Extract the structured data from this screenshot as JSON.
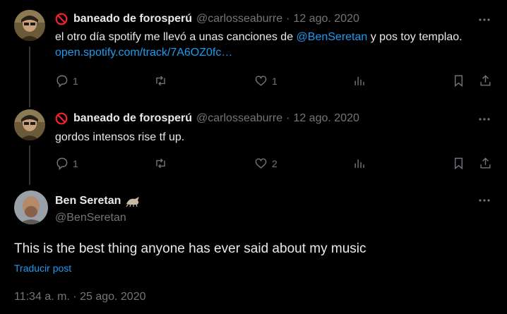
{
  "tweets": [
    {
      "display_name": "baneado de forosperú",
      "handle": "@carlosseaburre",
      "date": "12 ago. 2020",
      "text_pre": "el otro día spotify me llevó a unas canciones de ",
      "mention": "@BenSeretan",
      "text_mid": " y pos toy templao. ",
      "link": "open.spotify.com/track/7A6OZ0fc…",
      "replies": "1",
      "retweets": "",
      "likes": "1"
    },
    {
      "display_name": "baneado de forosperú",
      "handle": "@carlosseaburre",
      "date": "12 ago. 2020",
      "text": "gordos intensos rise tf up.",
      "replies": "1",
      "retweets": "",
      "likes": "2"
    }
  ],
  "main": {
    "display_name": "Ben Seretan",
    "handle": "@BenSeretan",
    "text": "This is the best thing anyone has ever said about my music",
    "translate": "Traducir post",
    "time": "11:34 a. m. · 25 ago. 2020"
  },
  "separator": "·",
  "icons": [
    "ban-icon",
    "more-icon",
    "reply-icon",
    "retweet-icon",
    "like-icon",
    "views-icon",
    "bookmark-icon",
    "share-icon",
    "crab-emoji-icon"
  ],
  "colors": {
    "background": "#000000",
    "text": "#e7e9ea",
    "muted": "#71767b",
    "link": "#1d9bf0",
    "ban": "#f4212e"
  }
}
